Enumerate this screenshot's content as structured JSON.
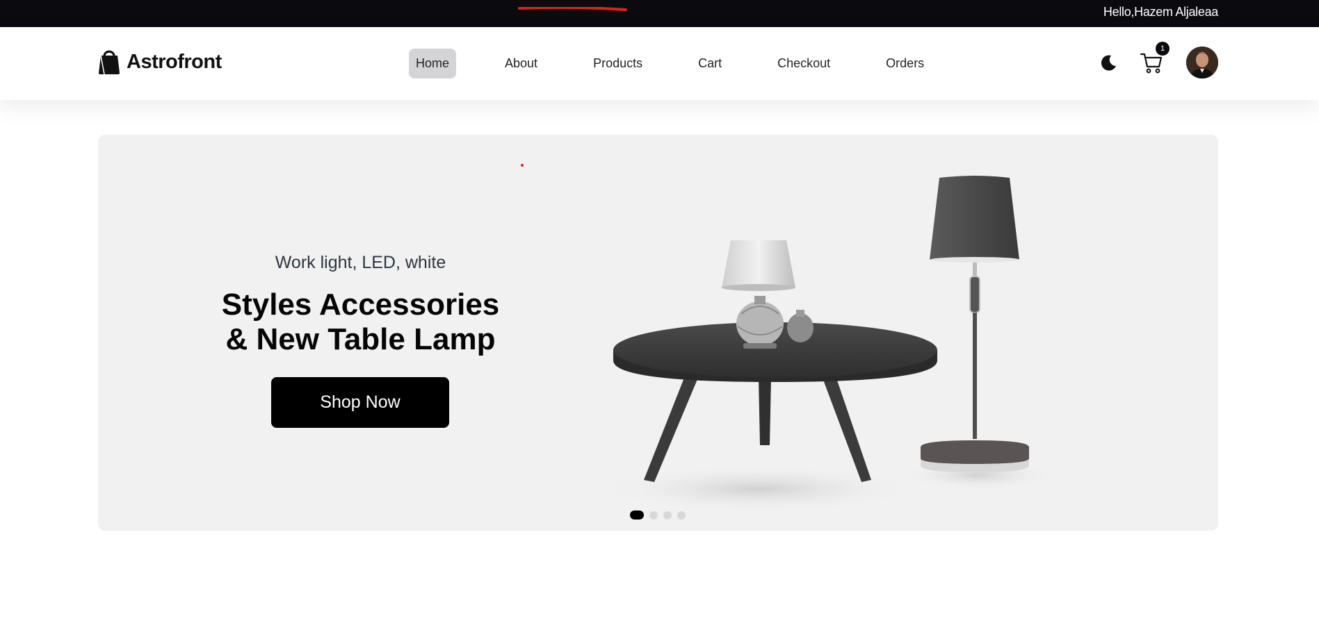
{
  "topbar": {
    "greeting": "Hello,Hazem Aljaleaa",
    "annotation_color": "#e02020"
  },
  "brand": {
    "name": "Astrofront",
    "icon": "shopping-bag-icon"
  },
  "nav": {
    "items": [
      {
        "label": "Home",
        "active": true
      },
      {
        "label": "About",
        "active": false
      },
      {
        "label": "Products",
        "active": false
      },
      {
        "label": "Cart",
        "active": false
      },
      {
        "label": "Checkout",
        "active": false
      },
      {
        "label": "Orders",
        "active": false
      }
    ]
  },
  "actions": {
    "theme_icon": "moon-icon",
    "cart_icon": "cart-icon",
    "cart_count": "1",
    "avatar_icon": "user-avatar"
  },
  "hero": {
    "subtitle": "Work light, LED, white",
    "title_line1": "Styles Accessories",
    "title_line2": "& New Table Lamp",
    "cta_label": "Shop Now",
    "slide_count": 4,
    "active_slide": 0,
    "background": "#f1f1f1"
  }
}
